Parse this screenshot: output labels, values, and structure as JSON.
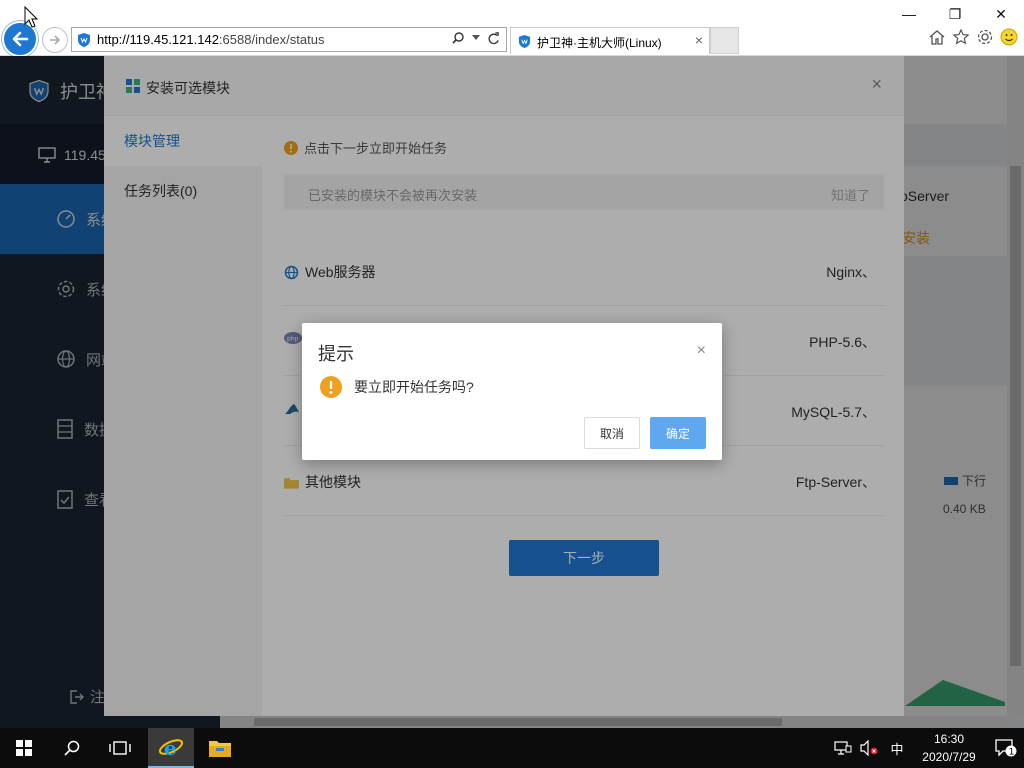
{
  "browser": {
    "url_host": "http://119.45.121.142",
    "url_rest": ":6588/index/status",
    "tab_title": "护卫神·主机大师(Linux)",
    "tab_close": "×",
    "win_minimize": "—",
    "win_restore": "❐",
    "win_close": "✕"
  },
  "sidebar": {
    "logo_text": "护卫神",
    "host": "119.45",
    "items": [
      {
        "label": "系统",
        "icon": "dashboard-icon",
        "active": true
      },
      {
        "label": "系统",
        "icon": "gear-icon",
        "active": false
      },
      {
        "label": "网站",
        "icon": "globe-icon",
        "active": false
      },
      {
        "label": "数据",
        "icon": "database-icon",
        "active": false
      },
      {
        "label": "查看",
        "icon": "checklist-icon",
        "active": false
      }
    ],
    "logout": "注"
  },
  "background": {
    "card_text": "oServer",
    "card_action": "安装",
    "legend_label": "下行",
    "download_value": "0.40 KB"
  },
  "module_modal": {
    "title": "安装可选模块",
    "close": "×",
    "nav": [
      {
        "label": "模块管理",
        "active": true
      },
      {
        "label": "任务列表(0)",
        "active": false
      }
    ],
    "tip": "点击下一步立即开始任务",
    "notice_text": "已安装的模块不会被再次安装",
    "notice_ok": "知道了",
    "modules": [
      {
        "name": "Web服务器",
        "value": "Nginx、",
        "icon": "globe-icon"
      },
      {
        "name": "",
        "value": "PHP-5.6、",
        "icon": "php-icon"
      },
      {
        "name": "",
        "value": "MySQL-5.7、",
        "icon": "mysql-icon"
      },
      {
        "name": "其他模块",
        "value": "Ftp-Server、",
        "icon": "folder-icon"
      }
    ],
    "next_button": "下一步"
  },
  "confirm_dialog": {
    "title": "提示",
    "close": "×",
    "message": "要立即开始任务吗?",
    "cancel": "取消",
    "ok": "确定"
  },
  "taskbar": {
    "time": "16:30",
    "date": "2020/7/29",
    "ime": "中",
    "notification_count": "1"
  },
  "colors": {
    "accent": "#1e78d2",
    "sidebar": "#1f2a38",
    "warning": "#f0a020",
    "ok_button": "#5fa8f0"
  }
}
